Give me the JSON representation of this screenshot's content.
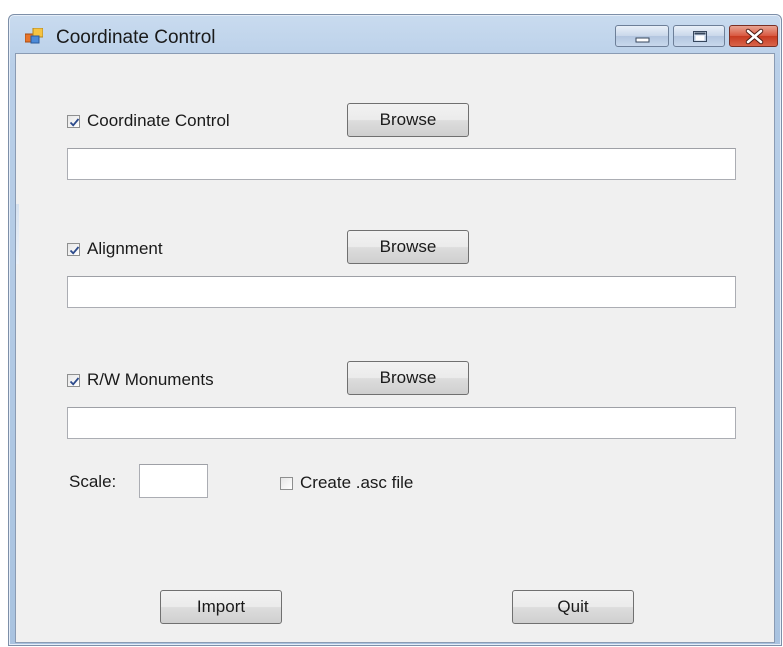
{
  "window": {
    "title": "Coordinate Control"
  },
  "sections": [
    {
      "checkbox_label": "Coordinate Control",
      "checked": true,
      "browse_label": "Browse",
      "path_value": ""
    },
    {
      "checkbox_label": "Alignment",
      "checked": true,
      "browse_label": "Browse",
      "path_value": ""
    },
    {
      "checkbox_label": "R/W Monuments",
      "checked": true,
      "browse_label": "Browse",
      "path_value": ""
    }
  ],
  "scale": {
    "label": "Scale:",
    "value": ""
  },
  "create_asc": {
    "label": "Create .asc file",
    "checked": false
  },
  "buttons": {
    "import_label": "Import",
    "quit_label": "Quit"
  },
  "icons": {
    "app": "app-window-icon",
    "minimize": "minimize-icon",
    "maximize": "maximize-icon",
    "close": "close-icon",
    "check": "check-icon"
  }
}
